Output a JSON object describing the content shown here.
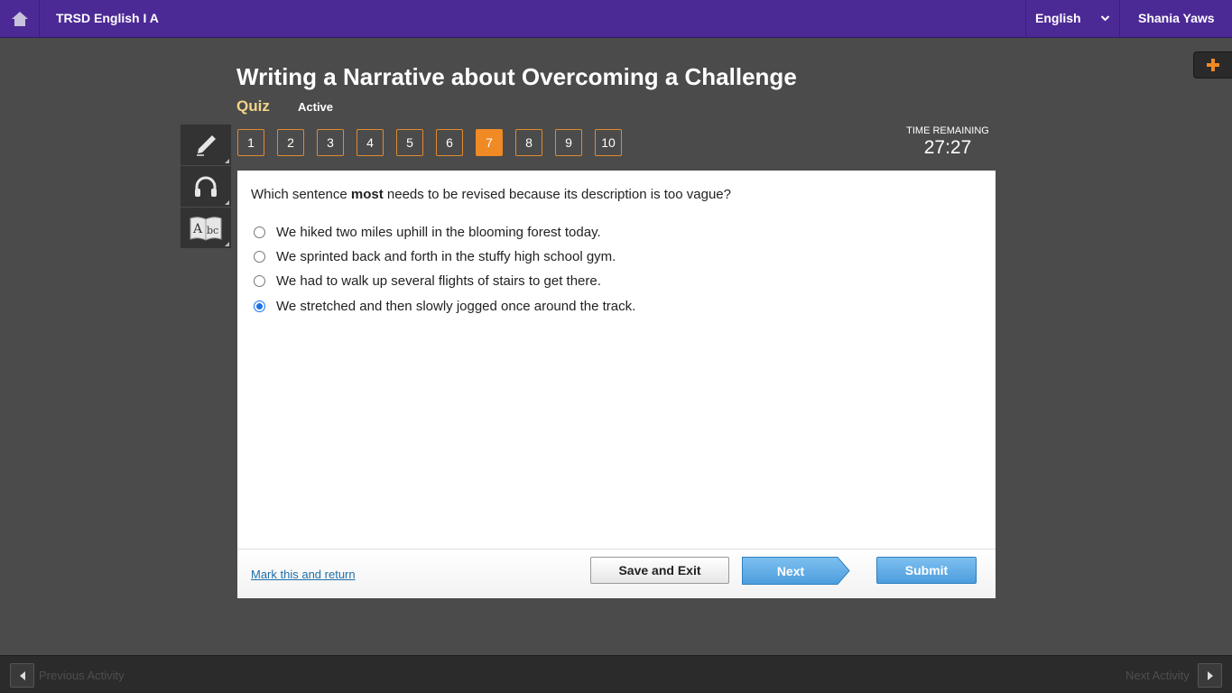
{
  "header": {
    "course_title": "TRSD English I A",
    "language": "English",
    "user_name": "Shania Yaws"
  },
  "lesson": {
    "title": "Writing a Narrative about Overcoming a Challenge",
    "type": "Quiz",
    "status": "Active"
  },
  "tools": [
    "pencil-icon",
    "headphones-icon",
    "dictionary-icon"
  ],
  "question_nav": {
    "items": [
      "1",
      "2",
      "3",
      "4",
      "5",
      "6",
      "7",
      "8",
      "9",
      "10"
    ],
    "current": "7"
  },
  "timer": {
    "label": "TIME REMAINING",
    "value": "27:27"
  },
  "question": {
    "text_before": "Which sentence ",
    "text_bold": "most",
    "text_after": " needs to be revised because its description is too vague?",
    "options": [
      "We hiked two miles uphill in the blooming forest today.",
      "We sprinted back and forth in the stuffy high school gym.",
      "We had to walk up several flights of stairs to get there.",
      "We stretched and then slowly jogged once around the track."
    ],
    "selected_index": 3
  },
  "footer": {
    "mark_link": "Mark this and return",
    "save_label": "Save and Exit",
    "next_label": "Next",
    "submit_label": "Submit"
  },
  "bottom_nav": {
    "prev_label": "Previous Activity",
    "next_label": "Next Activity"
  },
  "colors": {
    "topbar": "#4c2a96",
    "accent": "#f08a24",
    "quiz_label": "#f2d58a",
    "button_blue": "#4c9ddd",
    "link": "#1e6fa8"
  }
}
